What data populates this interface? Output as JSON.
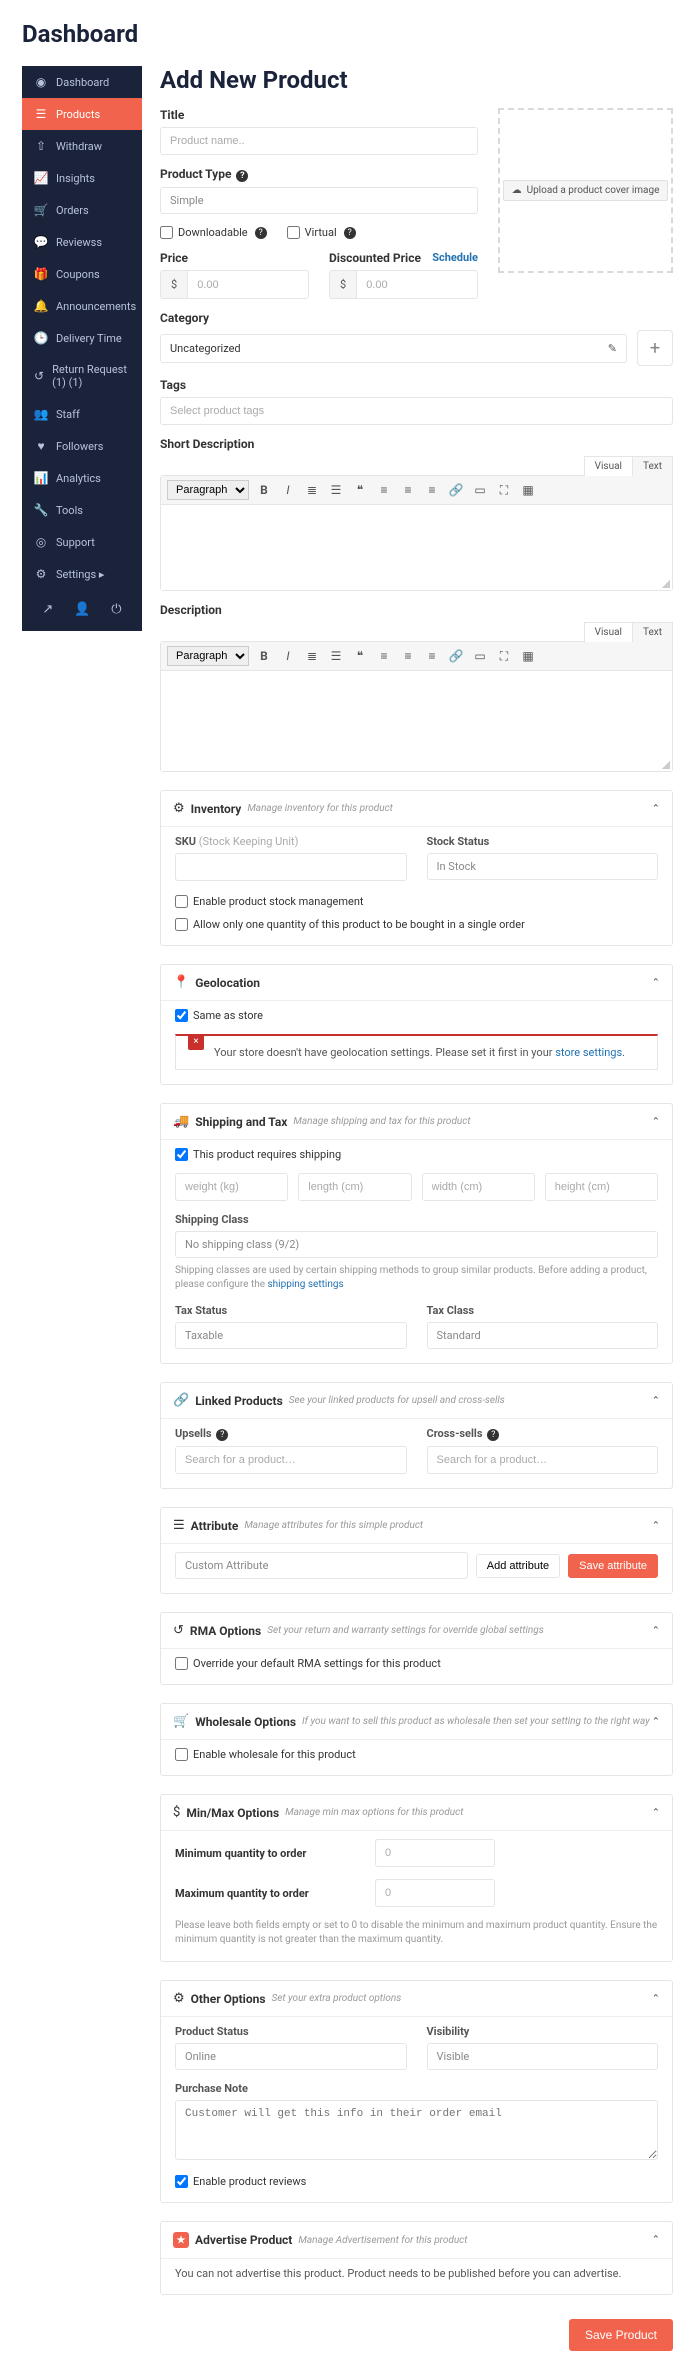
{
  "dashboard_title": "Dashboard",
  "page_title": "Add New Product",
  "sidebar": [
    {
      "icon": "◉",
      "label": "Dashboard"
    },
    {
      "icon": "☰",
      "label": "Products"
    },
    {
      "icon": "⇧",
      "label": "Withdraw"
    },
    {
      "icon": "📈",
      "label": "Insights"
    },
    {
      "icon": "🛒",
      "label": "Orders"
    },
    {
      "icon": "💬",
      "label": "Reviewss"
    },
    {
      "icon": "🎁",
      "label": "Coupons"
    },
    {
      "icon": "🔔",
      "label": "Announcements"
    },
    {
      "icon": "🕒",
      "label": "Delivery Time"
    },
    {
      "icon": "↺",
      "label": "Return Request (1) (1)"
    },
    {
      "icon": "👥",
      "label": "Staff"
    },
    {
      "icon": "♥",
      "label": "Followers"
    },
    {
      "icon": "📊",
      "label": "Analytics"
    },
    {
      "icon": "🔧",
      "label": "Tools"
    },
    {
      "icon": "◎",
      "label": "Support"
    },
    {
      "icon": "⚙",
      "label": "Settings  ▸"
    }
  ],
  "fields": {
    "title_label": "Title",
    "title_placeholder": "Product name..",
    "product_type_label": "Product Type",
    "product_type_value": "Simple",
    "downloadable": "Downloadable",
    "virtual": "Virtual",
    "price_label": "Price",
    "discounted_label": "Discounted Price",
    "schedule": "Schedule",
    "currency": "$",
    "price_placeholder": "0.00",
    "category_label": "Category",
    "category_value": "Uncategorized",
    "tags_label": "Tags",
    "tags_placeholder": "Select product tags",
    "upload_label": "Upload a product cover image",
    "short_desc_label": "Short Description",
    "desc_label": "Description"
  },
  "editor_tabs": {
    "visual": "Visual",
    "text": "Text",
    "paragraph": "Paragraph"
  },
  "inventory": {
    "title": "Inventory",
    "sub": "Manage inventory for this product",
    "sku_label": "SKU",
    "sku_hint": "(Stock Keeping Unit)",
    "stock_status_label": "Stock Status",
    "stock_status_value": "In Stock",
    "chk1": "Enable product stock management",
    "chk2": "Allow only one quantity of this product to be bought in a single order"
  },
  "geo": {
    "title": "Geolocation",
    "same": "Same as store",
    "alert_pre": "Your store doesn't have geolocation settings. Please set it first in your ",
    "alert_link": "store settings"
  },
  "shipping": {
    "title": "Shipping and Tax",
    "sub": "Manage shipping and tax for this product",
    "requires": "This product requires shipping",
    "weight": "weight (kg)",
    "length": "length (cm)",
    "width": "width (cm)",
    "height": "height (cm)",
    "class_label": "Shipping Class",
    "class_value": "No shipping class (9/2)",
    "note_pre": "Shipping classes are used by certain shipping methods to group similar products. Before adding a product, please configure the ",
    "note_link": "shipping settings",
    "tax_status_label": "Tax Status",
    "tax_status_value": "Taxable",
    "tax_class_label": "Tax Class",
    "tax_class_value": "Standard"
  },
  "linked": {
    "title": "Linked Products",
    "sub": "See your linked products for upsell and cross-sells",
    "upsells": "Upsells",
    "cross": "Cross-sells",
    "placeholder": "Search for a product…"
  },
  "attribute": {
    "title": "Attribute",
    "sub": "Manage attributes for this simple product",
    "select": "Custom Attribute",
    "add": "Add attribute",
    "save": "Save attribute"
  },
  "rma": {
    "title": "RMA Options",
    "sub": "Set your return and warranty settings for override global settings",
    "chk": "Override your default RMA settings for this product"
  },
  "wholesale": {
    "title": "Wholesale Options",
    "sub": "If you want to sell this product as wholesale then set your setting to the right way",
    "chk": "Enable wholesale for this product"
  },
  "minmax": {
    "title": "Min/Max Options",
    "sub": "Manage min max options for this product",
    "min_label": "Minimum quantity to order",
    "max_label": "Maximum quantity to order",
    "zero": "0",
    "note": "Please leave both fields empty or set to 0 to disable the minimum and maximum product quantity. Ensure the minimum quantity is not greater than the maximum quantity."
  },
  "other": {
    "title": "Other Options",
    "sub": "Set your extra product options",
    "status_label": "Product Status",
    "status_value": "Online",
    "visibility_label": "Visibility",
    "visibility_value": "Visible",
    "note_label": "Purchase Note",
    "note_placeholder": "Customer will get this info in their order email",
    "reviews": "Enable product reviews"
  },
  "advertise": {
    "title": "Advertise Product",
    "sub": "Manage Advertisement for this product",
    "msg": "You can not advertise this product. Product needs to be published before you can advertise."
  },
  "save_btn": "Save Product"
}
